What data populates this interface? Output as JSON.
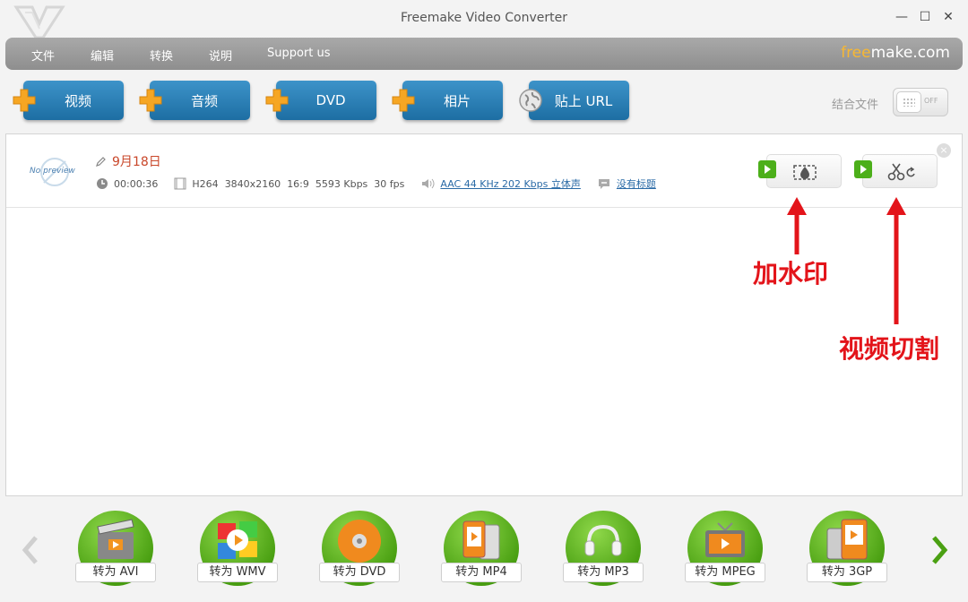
{
  "window": {
    "title": "Freemake Video Converter",
    "controls": [
      "minimize",
      "maximize",
      "close"
    ]
  },
  "menu": {
    "items": [
      "文件",
      "编辑",
      "转换",
      "说明",
      "Support us"
    ],
    "brand_free": "free",
    "brand_make": "make.com"
  },
  "toolbar": {
    "buttons": [
      {
        "label": "视频",
        "icon": "plus-icon"
      },
      {
        "label": "音频",
        "icon": "plus-icon"
      },
      {
        "label": "DVD",
        "icon": "plus-icon"
      },
      {
        "label": "相片",
        "icon": "plus-icon"
      },
      {
        "label": "贴上 URL",
        "icon": "globe-icon"
      }
    ],
    "combine_label": "结合文件",
    "toggle_state": "OFF"
  },
  "file": {
    "thumbnail": "No preview",
    "name": "9月18日",
    "duration": "00:00:36",
    "video": {
      "codec": "H264",
      "resolution": "3840x2160",
      "aspect": "16:9",
      "bitrate": "5593 Kbps",
      "fps": "30 fps"
    },
    "audio": "AAC  44 KHz  202 Kbps  立体声",
    "subtitle": "没有标题"
  },
  "annotations": {
    "watermark": "加水印",
    "cut": "视频切割",
    "color": "#e3141a"
  },
  "formats": [
    "转为 AVI",
    "转为 WMV",
    "转为 DVD",
    "转为 MP4",
    "转为 MP3",
    "转为 MPEG",
    "转为 3GP"
  ],
  "colors": {
    "accent_blue": "#1d6ea3",
    "format_green": "#4aa012",
    "filename_red": "#c9472a",
    "brand_orange": "#f7b733"
  }
}
